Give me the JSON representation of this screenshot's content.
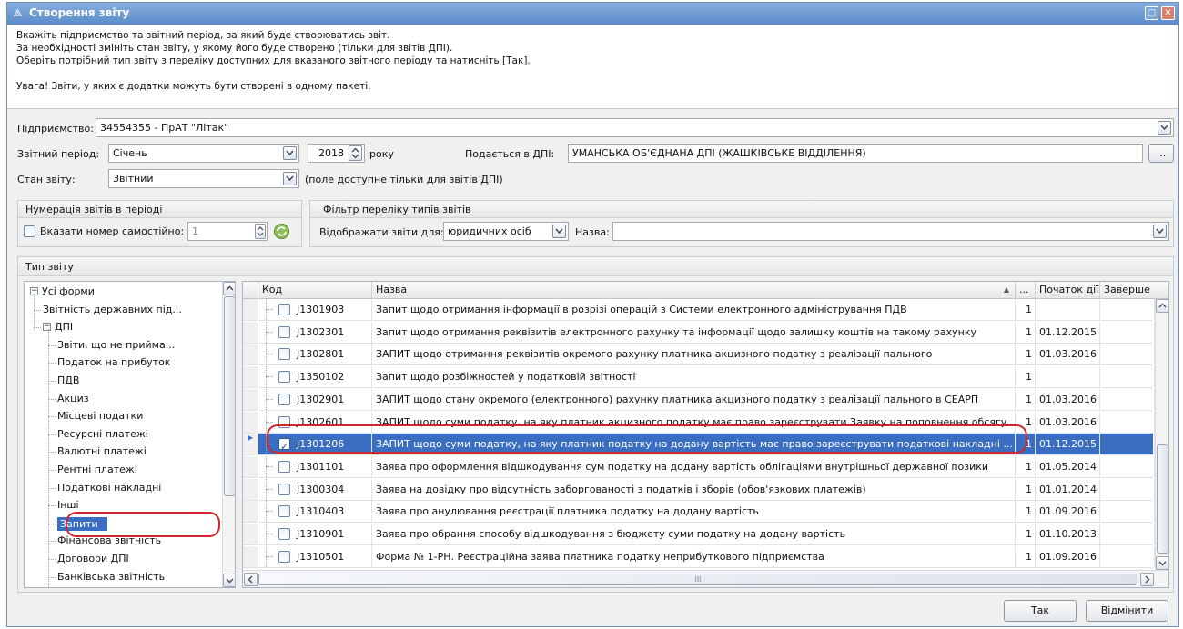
{
  "window": {
    "title": "Створення звіту"
  },
  "instructions": {
    "line1": "Вкажіть підприємство та звітний період, за який буде створюватись звіт.",
    "line2": "За необхідності змініть стан звіту, у якому його буде створено (тільки для звітів ДПІ).",
    "line3": "Оберіть потрібний тип звіту з переліку доступних для вказаного звітного періоду та натисніть [Так].",
    "line4": "Увага! Звіти, у яких є додатки можуть бути створені в одному пакеті."
  },
  "form": {
    "enterprise_label": "Підприємство:",
    "enterprise_value": "34554355 - ПрАТ \"Літак\"",
    "period_label": "Звітний період:",
    "period_value": "Січень",
    "year_value": "2018",
    "year_suffix": "року",
    "dpi_label": "Подається в ДПІ:",
    "dpi_value": "УМАНСЬКА ОБ'ЄДНАНА ДПІ (ЖАШКІВСЬКЕ ВІДДІЛЕННЯ)",
    "dpi_browse": "...",
    "state_label": "Стан звіту:",
    "state_value": "Звітний",
    "state_note": "(поле доступне тільки для звітів ДПІ)"
  },
  "numbering": {
    "title": "Нумерація звітів в періоді",
    "checkbox_label": "Вказати номер самостійно:",
    "number_value": "1"
  },
  "filter": {
    "title": "Фільтр переліку типів звітів",
    "show_label": "Відображати звіти для:",
    "show_value": "юридичних осіб",
    "name_label": "Назва:",
    "name_value": ""
  },
  "report_type": {
    "title": "Тип звіту",
    "tree": [
      {
        "label": "Усі форми",
        "level": 0,
        "expander": "−"
      },
      {
        "label": "Звітність державних під...",
        "level": 1
      },
      {
        "label": "ДПІ",
        "level": 1,
        "expander": "−"
      },
      {
        "label": "Звіти, що не прийма...",
        "level": 2
      },
      {
        "label": "Податок на прибуток",
        "level": 2
      },
      {
        "label": "ПДВ",
        "level": 2
      },
      {
        "label": "Акциз",
        "level": 2
      },
      {
        "label": "Місцеві податки",
        "level": 2
      },
      {
        "label": "Ресурсні платежі",
        "level": 2
      },
      {
        "label": "Валютні платежі",
        "level": 2
      },
      {
        "label": "Рентні платежі",
        "level": 2
      },
      {
        "label": "Податкові накладні",
        "level": 2
      },
      {
        "label": "Інші",
        "level": 2
      },
      {
        "label": "Запити",
        "level": 2,
        "selected": true
      },
      {
        "label": "Фінансова звітність",
        "level": 2
      },
      {
        "label": "Договори ДПІ",
        "level": 2
      },
      {
        "label": "Банківська звітність",
        "level": 2
      }
    ]
  },
  "grid": {
    "columns": {
      "code": "Код",
      "name": "Назва",
      "dots": "...",
      "start": "Початок дії",
      "end": "Заверше"
    },
    "rows": [
      {
        "code": "J1301903",
        "name": "Запит щодо отримання інформації в розрізі операцій з Системи електронного адміністрування ПДВ",
        "n": "1",
        "start": "",
        "checked": false
      },
      {
        "code": "J1302301",
        "name": "Запит щодо отримання реквізитів електронного рахунку та інформації щодо залишку коштів на такому рахунку",
        "n": "1",
        "start": "01.12.2015",
        "checked": false
      },
      {
        "code": "J1302801",
        "name": "ЗАПИТ щодо отримання реквізитів окремого рахунку платника акцизного податку з реалізації пального",
        "n": "1",
        "start": "01.03.2016",
        "checked": false
      },
      {
        "code": "J1350102",
        "name": "Запит щодо розбіжностей у податковій звітності",
        "n": "1",
        "start": "",
        "checked": false
      },
      {
        "code": "J1302901",
        "name": "ЗАПИТ щодо стану окремого (електронного) рахунку платника акцизного податку з реалізації пального в СЕАРП",
        "n": "1",
        "start": "01.03.2016",
        "checked": false
      },
      {
        "code": "J1302601",
        "name": "ЗАПИТ щодо суми податку, на яку платник акцизного податку має право зареєструвати Заявку на поповнення обсягу...",
        "n": "1",
        "start": "01.03.2016",
        "checked": false
      },
      {
        "code": "J1301206",
        "name": "ЗАПИТ щодо суми податку, на яку платник податку на додану вартість має право зареєструвати податкові накладні ...",
        "n": "1",
        "start": "01.12.2015",
        "checked": true,
        "selected": true
      },
      {
        "code": "J1301101",
        "name": "Заява  про оформлення відшкодування сум податку на додану вартість облігаціями внутрішньої державної позики",
        "n": "1",
        "start": "01.05.2014",
        "checked": false
      },
      {
        "code": "J1300304",
        "name": "Заява на довідку про відсутність заборгованості з податків і зборів (обов'язкових платежів)",
        "n": "1",
        "start": "01.01.2014",
        "checked": false
      },
      {
        "code": "J1310403",
        "name": "Заява про анулювання реєстрації платника податку на додану вартість",
        "n": "1",
        "start": "01.09.2016",
        "checked": false
      },
      {
        "code": "J1310901",
        "name": "Заява про обрання способу відшкодування з бюджету суми податку на додану вартість",
        "n": "1",
        "start": "01.10.2013",
        "checked": false
      },
      {
        "code": "J1310501",
        "name": "Форма № 1-РН. Реєстраційна заява платника податку неприбуткового підприємства",
        "n": "1",
        "start": "01.09.2016",
        "checked": false
      }
    ],
    "hscroll_mark": "III"
  },
  "buttons": {
    "ok": "Так",
    "cancel": "Відмінити"
  }
}
